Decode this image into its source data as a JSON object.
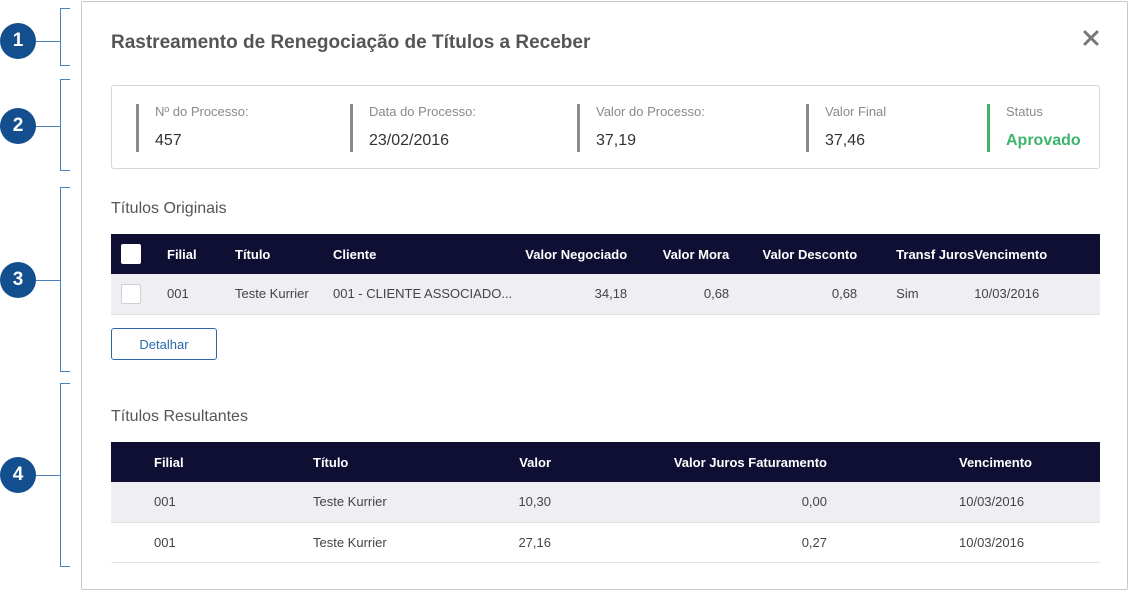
{
  "markers": [
    "1",
    "2",
    "3",
    "4"
  ],
  "modal": {
    "title": "Rastreamento de Renegociação de Títulos a Receber",
    "close_icon": "close-icon"
  },
  "summary": {
    "process_number": {
      "label": "Nº do Processo:",
      "value": "457"
    },
    "process_date": {
      "label": "Data do Processo:",
      "value": "23/02/2016"
    },
    "process_value": {
      "label": "Valor do Processo:",
      "value": "37,19"
    },
    "final_value": {
      "label": "Valor Final",
      "value": "37,46"
    },
    "status": {
      "label": "Status",
      "value": "Aprovado",
      "color": "#3fb46b"
    }
  },
  "original_titles": {
    "section_title": "Títulos Originais",
    "columns": [
      "Filial",
      "Título",
      "Cliente",
      "Valor Negociado",
      "Valor Mora",
      "Valor Desconto",
      "Transf Juros",
      "Vencimento"
    ],
    "rows": [
      {
        "filial": "001",
        "titulo": "Teste Kurrier",
        "cliente": "001 - CLIENTE ASSOCIADO...",
        "valor_negociado": "34,18",
        "valor_mora": "0,68",
        "valor_desconto": "0,68",
        "transf_juros": "Sim",
        "vencimento": "10/03/2016"
      }
    ],
    "detail_button": "Detalhar"
  },
  "resulting_titles": {
    "section_title": "Títulos Resultantes",
    "columns": [
      "Filial",
      "Título",
      "Valor",
      "Valor Juros Faturamento",
      "Vencimento"
    ],
    "rows": [
      {
        "filial": "001",
        "titulo": "Teste Kurrier",
        "valor": "10,30",
        "valor_juros": "0,00",
        "vencimento": "10/03/2016"
      },
      {
        "filial": "001",
        "titulo": "Teste Kurrier",
        "valor": "27,16",
        "valor_juros": "0,27",
        "vencimento": "10/03/2016"
      }
    ]
  },
  "colors": {
    "header_bg": "#0f0f33",
    "marker_bg": "#134e8e",
    "accent": "#2a6aa8"
  }
}
